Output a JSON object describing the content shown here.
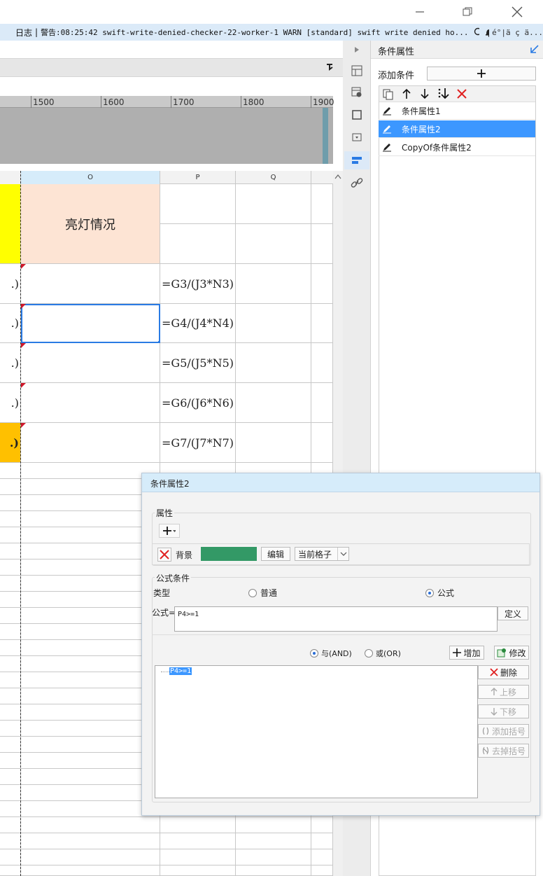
{
  "log": {
    "label": "日志",
    "text": "警告:08:25:42 swift-write-denied-checker-22-worker-1 WARN [standard] swift write denied ho...",
    "tail": "é°|ä   ç   ä..."
  },
  "ruler": {
    "ticks": [
      "1500",
      "1600",
      "1700",
      "1800",
      "1900"
    ]
  },
  "sheet": {
    "columns": [
      "O",
      "P",
      "Q"
    ],
    "header_cell": "亮灯情况",
    "left_stubs": [
      ".)",
      ".)",
      ".)",
      ".)",
      ".)"
    ],
    "formulas": [
      "=G3/(J3*N3)",
      "=G4/(J4*N4)",
      "=G5/(J5*N5)",
      "=G6/(J6*N6)",
      "=G7/(J7*N7)"
    ],
    "colors": {
      "yellow": "#ffff00",
      "header_bg": "#fde4d4",
      "orange": "#ffc000",
      "selected": "#2a7be4"
    }
  },
  "right_panel": {
    "title": "条件属性",
    "add_condition_label": "添加条件",
    "add_icon": "plus-icon",
    "items": [
      "条件属性1",
      "条件属性2",
      "CopyOf条件属性2"
    ],
    "selected_index": 1,
    "accent": "#3c97ff"
  },
  "dialog": {
    "title": "条件属性2",
    "attr_group_label": "属性",
    "bg_label": "背景",
    "bg_color": "#339966",
    "edit_btn": "编辑",
    "scope_value": "当前格子",
    "formula_group_label": "公式条件",
    "type_label": "类型",
    "type_normal": "普通",
    "type_formula": "公式",
    "formula_label": "公式=",
    "formula_value": "P4>=1",
    "define_btn": "定义",
    "and_label": "与(AND)",
    "or_label": "或(OR)",
    "add_btn": "增加",
    "modify_btn": "修改",
    "delete_btn": "删除",
    "up_btn": "上移",
    "down_btn": "下移",
    "add_bracket_btn": "添加括号",
    "remove_bracket_btn": "去掉括号",
    "tree_item": "P4>=1"
  }
}
